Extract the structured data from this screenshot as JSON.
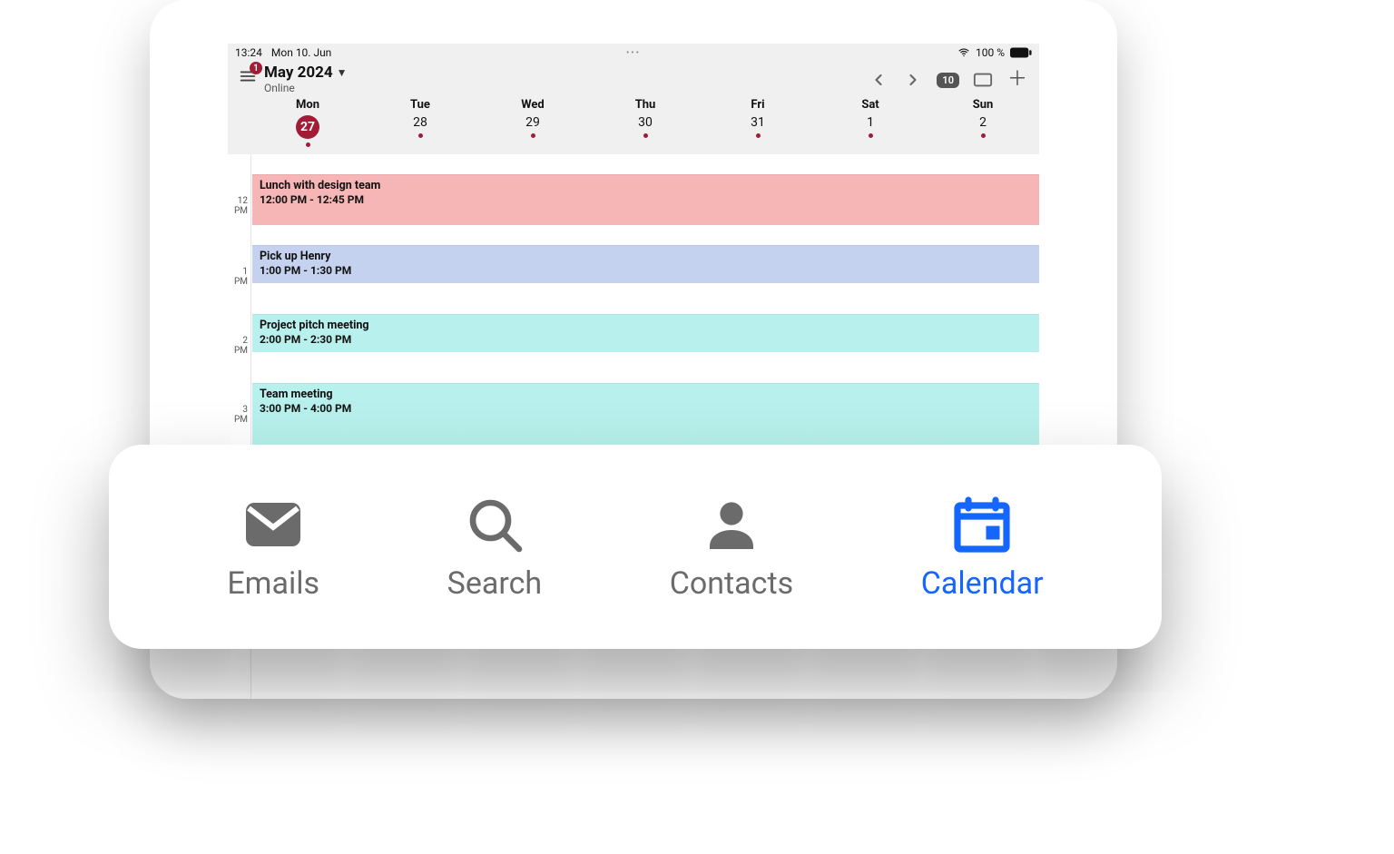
{
  "status": {
    "time": "13:24",
    "date": "Mon 10. Jun",
    "battery": "100 %"
  },
  "header": {
    "menu_badge": "1",
    "title": "May 2024",
    "subtitle": "Online",
    "date_pill": "10"
  },
  "week": [
    {
      "name": "Mon",
      "num": "27",
      "today": true
    },
    {
      "name": "Tue",
      "num": "28",
      "today": false
    },
    {
      "name": "Wed",
      "num": "29",
      "today": false
    },
    {
      "name": "Thu",
      "num": "30",
      "today": false
    },
    {
      "name": "Fri",
      "num": "31",
      "today": false
    },
    {
      "name": "Sat",
      "num": "1",
      "today": false
    },
    {
      "name": "Sun",
      "num": "2",
      "today": false
    }
  ],
  "time_labels": {
    "t12h": "12",
    "t12m": "PM",
    "t1h": "1",
    "t1m": "PM",
    "t2h": "2",
    "t2m": "PM",
    "t3h": "3",
    "t3m": "PM"
  },
  "events": [
    {
      "title": "Lunch with design team",
      "time": "12:00 PM - 12:45 PM",
      "color": "pink"
    },
    {
      "title": "Pick up Henry",
      "time": "1:00 PM - 1:30 PM",
      "color": "blue"
    },
    {
      "title": "Project pitch meeting",
      "time": "2:00 PM - 2:30 PM",
      "color": "cyan"
    },
    {
      "title": "Team meeting",
      "time": "3:00 PM - 4:00 PM",
      "color": "cyan"
    }
  ],
  "nav": {
    "emails": "Emails",
    "search": "Search",
    "contacts": "Contacts",
    "calendar": "Calendar"
  }
}
